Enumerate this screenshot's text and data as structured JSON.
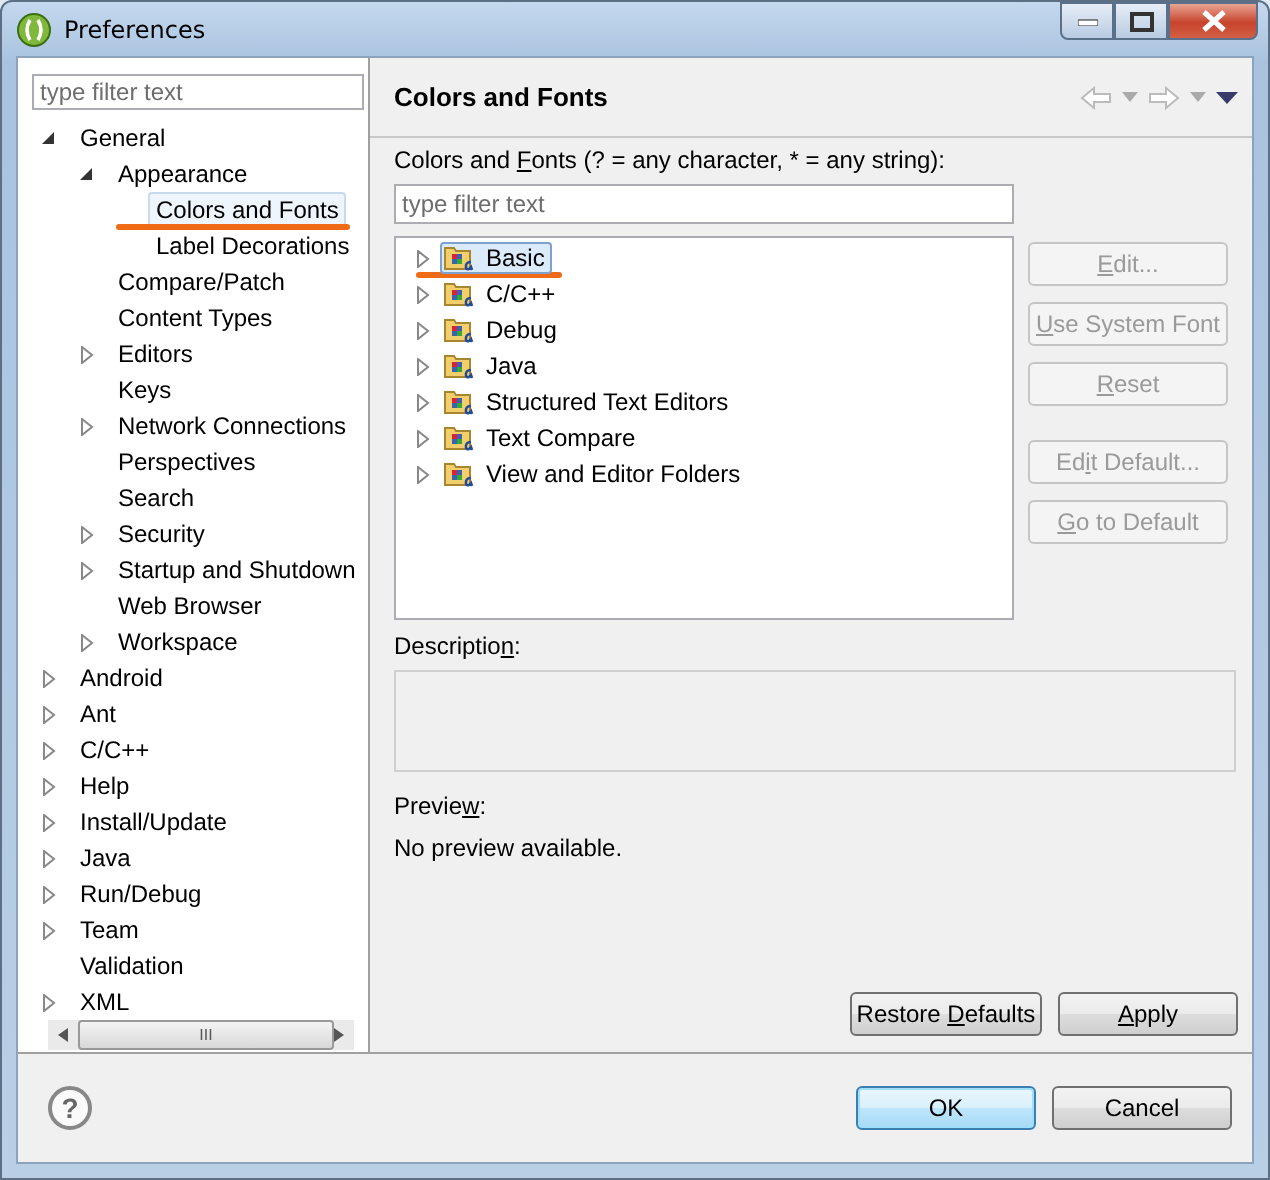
{
  "window": {
    "title": "Preferences"
  },
  "sidebar": {
    "filter": {
      "placeholder": "type filter text"
    },
    "tree": [
      {
        "label": "General",
        "kind": "expanded",
        "selected": false,
        "annotated": false,
        "children": [
          {
            "label": "Appearance",
            "kind": "expanded",
            "selected": false,
            "annotated": false,
            "children": [
              {
                "label": "Colors and Fonts",
                "kind": "leaf",
                "selected": true,
                "annotated": true
              },
              {
                "label": "Label Decorations",
                "kind": "leaf",
                "selected": false,
                "annotated": false
              }
            ]
          },
          {
            "label": "Compare/Patch",
            "kind": "leaf",
            "selected": false,
            "annotated": false
          },
          {
            "label": "Content Types",
            "kind": "leaf",
            "selected": false,
            "annotated": false
          },
          {
            "label": "Editors",
            "kind": "collapsed",
            "selected": false,
            "annotated": false
          },
          {
            "label": "Keys",
            "kind": "leaf",
            "selected": false,
            "annotated": false
          },
          {
            "label": "Network Connections",
            "kind": "collapsed",
            "selected": false,
            "annotated": false
          },
          {
            "label": "Perspectives",
            "kind": "leaf",
            "selected": false,
            "annotated": false
          },
          {
            "label": "Search",
            "kind": "leaf",
            "selected": false,
            "annotated": false
          },
          {
            "label": "Security",
            "kind": "collapsed",
            "selected": false,
            "annotated": false
          },
          {
            "label": "Startup and Shutdown",
            "kind": "collapsed",
            "selected": false,
            "annotated": false
          },
          {
            "label": "Web Browser",
            "kind": "leaf",
            "selected": false,
            "annotated": false
          },
          {
            "label": "Workspace",
            "kind": "collapsed",
            "selected": false,
            "annotated": false
          }
        ]
      },
      {
        "label": "Android",
        "kind": "collapsed",
        "selected": false,
        "annotated": false
      },
      {
        "label": "Ant",
        "kind": "collapsed",
        "selected": false,
        "annotated": false
      },
      {
        "label": "C/C++",
        "kind": "collapsed",
        "selected": false,
        "annotated": false
      },
      {
        "label": "Help",
        "kind": "collapsed",
        "selected": false,
        "annotated": false
      },
      {
        "label": "Install/Update",
        "kind": "collapsed",
        "selected": false,
        "annotated": false
      },
      {
        "label": "Java",
        "kind": "collapsed",
        "selected": false,
        "annotated": false
      },
      {
        "label": "Run/Debug",
        "kind": "collapsed",
        "selected": false,
        "annotated": false
      },
      {
        "label": "Team",
        "kind": "collapsed",
        "selected": false,
        "annotated": false
      },
      {
        "label": "Validation",
        "kind": "leaf",
        "selected": false,
        "annotated": false
      },
      {
        "label": "XML",
        "kind": "collapsed",
        "selected": false,
        "annotated": false
      }
    ],
    "scrollbar_thumb": "III"
  },
  "page": {
    "title": "Colors and Fonts",
    "filter_label": {
      "before": "Colors and ",
      "key": "F",
      "after": "onts (? = any character, * = any string):"
    },
    "filter": {
      "placeholder": "type filter text"
    },
    "tree": [
      {
        "label": "Basic",
        "selected": true,
        "annotated": true
      },
      {
        "label": "C/C++",
        "selected": false,
        "annotated": false
      },
      {
        "label": "Debug",
        "selected": false,
        "annotated": false
      },
      {
        "label": "Java",
        "selected": false,
        "annotated": false
      },
      {
        "label": "Structured Text Editors",
        "selected": false,
        "annotated": false
      },
      {
        "label": "Text Compare",
        "selected": false,
        "annotated": false
      },
      {
        "label": "View and Editor Folders",
        "selected": false,
        "annotated": false
      }
    ],
    "side_button_groups": [
      {
        "buttons": [
          {
            "key": "E",
            "after": "dit...",
            "disabled": true
          },
          {
            "key": "U",
            "after": "se System Font",
            "disabled": true
          },
          {
            "key": "R",
            "after": "eset",
            "disabled": true
          }
        ]
      },
      {
        "buttons": [
          {
            "before": "Ed",
            "key": "i",
            "after": "t Default...",
            "disabled": true
          },
          {
            "key": "G",
            "after": "o to Default",
            "disabled": true
          }
        ]
      }
    ],
    "description_label": {
      "before": "Descriptio",
      "key": "n",
      "after": ":"
    },
    "preview_label": {
      "before": "Previe",
      "key": "w",
      "after": ":"
    },
    "preview_text": "No preview available.",
    "buttons": [
      {
        "before": "Restore ",
        "key": "D",
        "after": "efaults",
        "disabled": false
      },
      {
        "key": "A",
        "after": "pply",
        "disabled": false
      }
    ]
  },
  "footer": {
    "buttons": [
      {
        "label": "OK",
        "default": true
      },
      {
        "label": "Cancel",
        "default": false
      }
    ],
    "help": "?"
  }
}
